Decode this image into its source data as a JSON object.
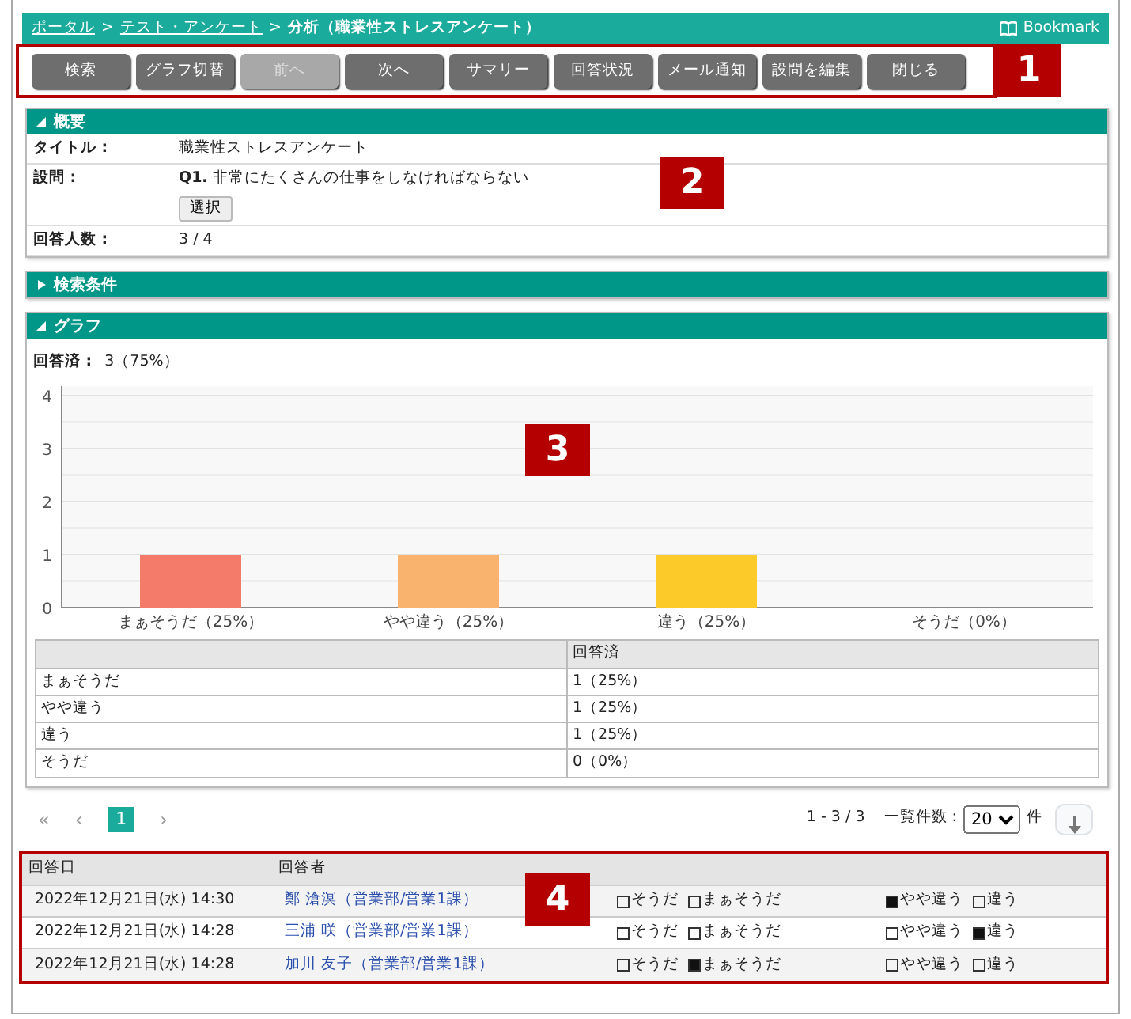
{
  "header": {
    "breadcrumb": [
      {
        "text": "ポータル",
        "link": true
      },
      {
        "text": "テスト・アンケート",
        "link": true
      },
      {
        "text": "分析（職業性ストレスアンケート）",
        "link": false
      }
    ],
    "separator": ">",
    "bookmark": "Bookmark"
  },
  "toolbar": {
    "callout": "1",
    "buttons": [
      {
        "label": "検索",
        "disabled": false
      },
      {
        "label": "グラフ切替",
        "disabled": false
      },
      {
        "label": "前へ",
        "disabled": true
      },
      {
        "label": "次へ",
        "disabled": false
      },
      {
        "label": "サマリー",
        "disabled": false
      },
      {
        "label": "回答状況",
        "disabled": false
      },
      {
        "label": "メール通知",
        "disabled": false
      },
      {
        "label": "設問を編集",
        "disabled": false
      },
      {
        "label": "閉じる",
        "disabled": false
      }
    ]
  },
  "summary": {
    "title": "概要",
    "expanded": true,
    "callout": "2",
    "rows": [
      {
        "label": "タイトル :",
        "value": "職業性ストレスアンケート"
      },
      {
        "label": "設問 :",
        "value": "**Q1.** 非常にたくさんの仕事をしなければならない",
        "button": "選択"
      },
      {
        "label": "回答人数 :",
        "value": "3 / 4"
      }
    ]
  },
  "search_conditions": {
    "title": "検索条件",
    "expanded": false
  },
  "graph": {
    "title": "グラフ",
    "expanded": true,
    "callout": "3",
    "answered_label": "回答済 :",
    "answered_value": "3（75%）",
    "chart_data": {
      "type": "bar",
      "categories": [
        "まぁそうだ（25%）",
        "やや違う（25%）",
        "違う（25%）",
        "そうだ（0%）"
      ],
      "values": [
        1,
        1,
        1,
        0
      ],
      "colors": [
        "#f47a6a",
        "#f9b36f",
        "#fccb2a",
        null
      ],
      "ylim": [
        0,
        4
      ],
      "yticks": [
        0,
        1,
        2,
        3,
        4
      ],
      "grid": true
    },
    "table": {
      "column_header": "回答済",
      "rows": [
        {
          "label": "まぁそうだ",
          "value": "1（25%）"
        },
        {
          "label": "やや違う",
          "value": "1（25%）"
        },
        {
          "label": "違う",
          "value": "1（25%）"
        },
        {
          "label": "そうだ",
          "value": "0（0%）"
        }
      ]
    }
  },
  "pagination": {
    "first": "«",
    "prev": "‹",
    "next": "›",
    "pages": [
      {
        "label": "1",
        "selected": true
      }
    ],
    "range": "1 - 3 / 3",
    "per_page_label": "一覧件数 :",
    "per_page": "20",
    "unit": "件"
  },
  "responses": {
    "callout": "4",
    "columns": [
      "回答日",
      "回答者"
    ],
    "rows": [
      {
        "date": "2022年12月21日(水) 14:30",
        "respondent": "鄭 滄溟（営業部/営業1課）",
        "options": [
          {
            "label": "そうだ",
            "checked": false
          },
          {
            "label": "まぁそうだ",
            "checked": false
          },
          {
            "label": "やや違う",
            "checked": true
          },
          {
            "label": "違う",
            "checked": false
          }
        ]
      },
      {
        "date": "2022年12月21日(水) 14:28",
        "respondent": "三浦 咲（営業部/営業1課）",
        "options": [
          {
            "label": "そうだ",
            "checked": false
          },
          {
            "label": "まぁそうだ",
            "checked": false
          },
          {
            "label": "やや違う",
            "checked": false
          },
          {
            "label": "違う",
            "checked": true
          }
        ]
      },
      {
        "date": "2022年12月21日(水) 14:28",
        "respondent": "加川 友子（営業部/営業1課）",
        "options": [
          {
            "label": "そうだ",
            "checked": false
          },
          {
            "label": "まぁそうだ",
            "checked": true
          },
          {
            "label": "やや違う",
            "checked": false
          },
          {
            "label": "違う",
            "checked": false
          }
        ]
      }
    ]
  }
}
